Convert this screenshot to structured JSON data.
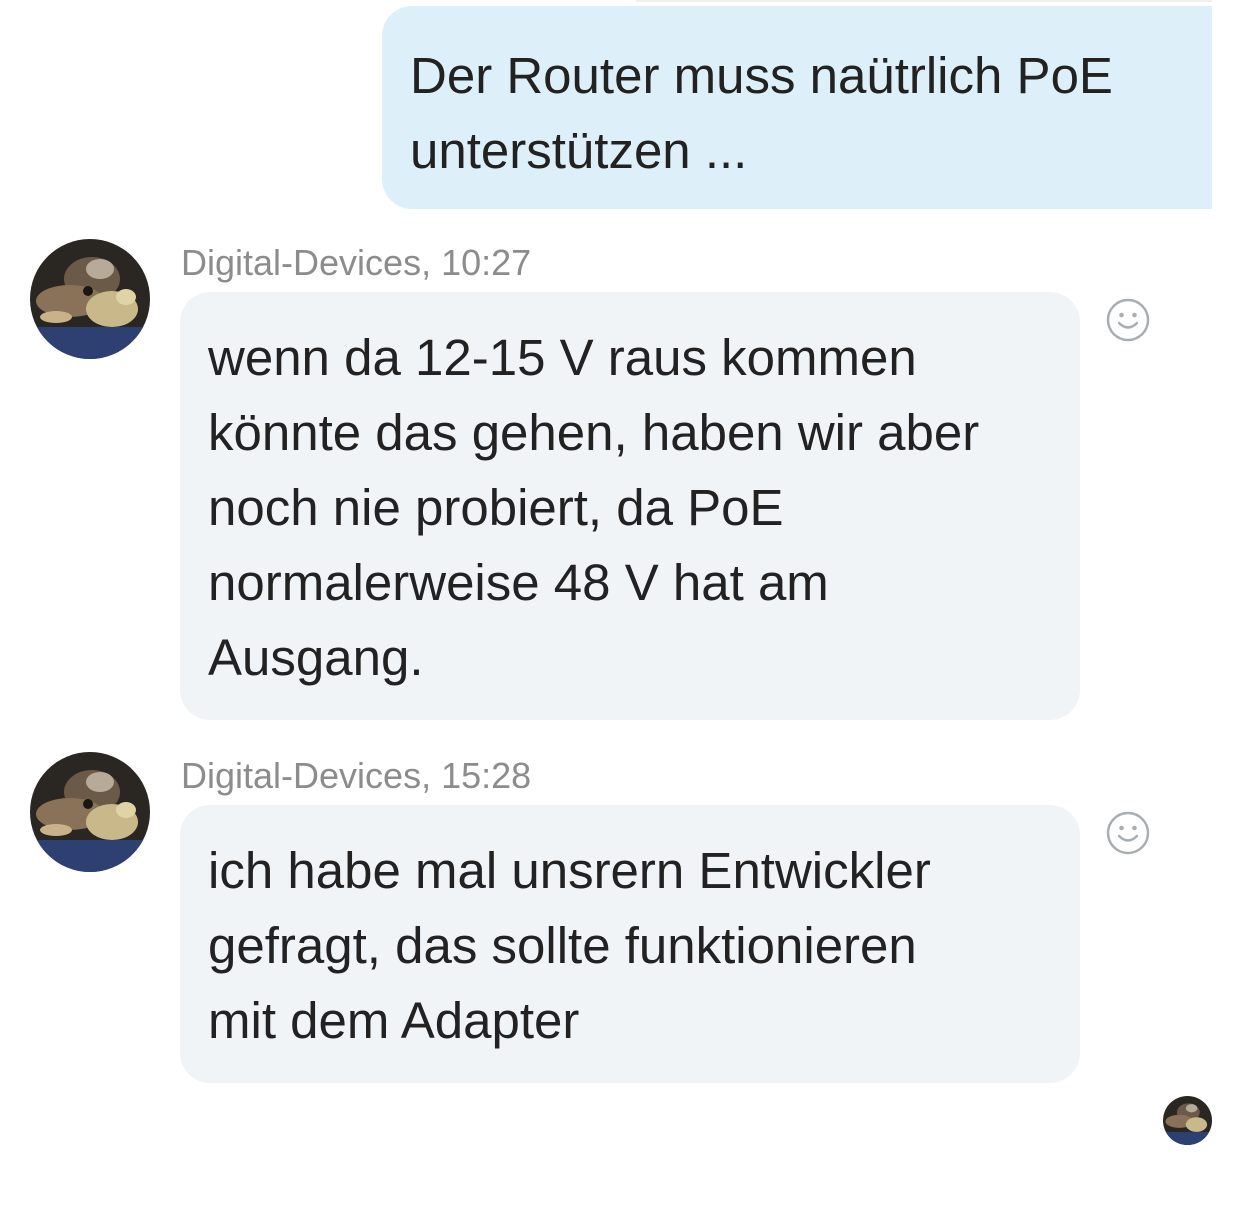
{
  "outgoing_message": {
    "lines": [
      "Der Router muss naütrlich PoE",
      "unterstützen ..."
    ]
  },
  "messages": [
    {
      "sender": "Digital-Devices, 10:27",
      "lines": [
        "wenn da 12-15 V raus kommen",
        "könnte das gehen, haben wir aber",
        "noch nie probiert, da PoE",
        "normalerweise 48 V hat am",
        "Ausgang."
      ],
      "reaction_icon": "smiley-icon"
    },
    {
      "sender": "Digital-Devices, 15:28",
      "lines": [
        "ich habe mal unsrern Entwickler",
        "gefragt, das sollte funktionieren",
        "mit dem Adapter"
      ],
      "reaction_icon": "smiley-icon"
    }
  ],
  "colors": {
    "outgoing_bubble": "#ddf0fa",
    "incoming_bubble": "#f1f4f7",
    "meta_text": "#8c8c8c"
  }
}
